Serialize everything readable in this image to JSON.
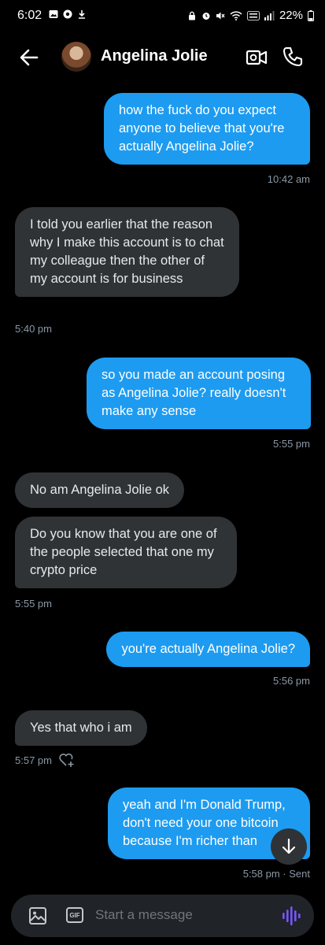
{
  "status_bar": {
    "time": "6:02",
    "battery": "22%",
    "icons": [
      "image-icon",
      "chrome-icon",
      "download-icon",
      "lock-icon",
      "alarm-icon",
      "mute-icon",
      "wifi-icon",
      "volte-icon",
      "signal-icon",
      "battery-icon"
    ]
  },
  "header": {
    "name": "Angelina Jolie",
    "icons": [
      "back-arrow-icon",
      "video-call-icon",
      "phone-icon"
    ]
  },
  "messages": [
    {
      "dir": "out",
      "text": "how the fuck do you expect anyone to believe that you're actually Angelina Jolie?",
      "time": "10:42 am"
    },
    {
      "dir": "in",
      "text": "I told you earlier that the reason why I make this account is to chat my colleague then the other of my account is for business",
      "time": "5:40 pm"
    },
    {
      "dir": "out",
      "text": "so you made an account posing as Angelina Jolie? really doesn't make any sense",
      "time": "5:55 pm"
    },
    {
      "dir": "in",
      "text": "No am Angelina Jolie ok"
    },
    {
      "dir": "in",
      "text": "Do you know that you are one of the people selected that one my crypto price",
      "time": "5:55 pm"
    },
    {
      "dir": "out",
      "text": "you're actually Angelina Jolie?",
      "time": "5:56 pm"
    },
    {
      "dir": "in",
      "text": "Yes that who i am",
      "time": "5:57 pm"
    },
    {
      "dir": "out",
      "text": "yeah and I'm Donald Trump, don't need your one bitcoin because I'm richer than",
      "time": "5:58 pm · Sent"
    }
  ],
  "composer": {
    "placeholder": "Start a message",
    "gif_label": "GIF"
  },
  "colors": {
    "outgoing": "#1d9bf0",
    "incoming": "#2f3336",
    "voice_accent": "#7856ff"
  }
}
